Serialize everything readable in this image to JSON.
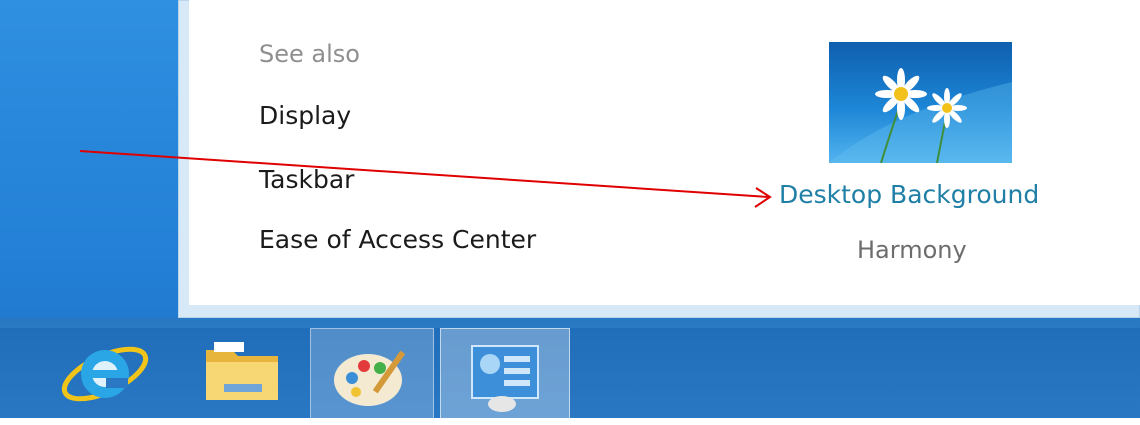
{
  "see_also": {
    "heading": "See also",
    "links": [
      "Display",
      "Taskbar",
      "Ease of Access Center"
    ]
  },
  "background": {
    "link_label": "Desktop Background",
    "theme_name": "Harmony"
  },
  "taskbar": {
    "apps": [
      {
        "name": "internet-explorer-icon"
      },
      {
        "name": "file-explorer-icon"
      },
      {
        "name": "paint-icon"
      },
      {
        "name": "control-panel-icon"
      }
    ]
  },
  "colors": {
    "link_accent": "#1f7fa6",
    "annotation_arrow": "#e00000",
    "taskbar": "#2a78c4"
  }
}
